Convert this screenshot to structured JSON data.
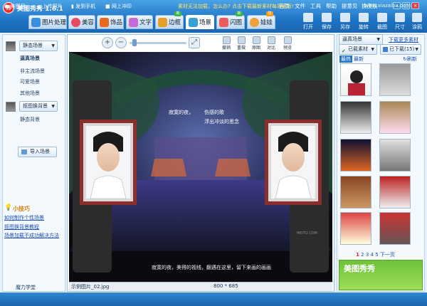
{
  "app": {
    "logo_text": "秀",
    "title": "美图秀秀 1.6.1"
  },
  "menu": [
    {
      "label": "首页"
    },
    {
      "label": "文件"
    },
    {
      "label": "工具"
    },
    {
      "label": "帮助"
    },
    {
      "label": "提意见"
    },
    {
      "label": "换皮肤"
    }
  ],
  "tabs": [
    {
      "label": "图片处理"
    },
    {
      "label": "美容"
    },
    {
      "label": "饰品"
    },
    {
      "label": "文字"
    },
    {
      "label": "边框",
      "badge": "新"
    },
    {
      "label": "场景"
    },
    {
      "label": "闪图",
      "badge": "新"
    },
    {
      "label": "娃娃",
      "badge": "热"
    }
  ],
  "tools": [
    {
      "label": "打开"
    },
    {
      "label": "保存"
    },
    {
      "label": "另存"
    },
    {
      "label": "旋转"
    },
    {
      "label": "截图"
    },
    {
      "label": "尺寸"
    },
    {
      "label": "涂鸦"
    }
  ],
  "left": {
    "dropdown1": "静态场景",
    "items1": [
      "逼真场景",
      "非主流场景",
      "可爱场景",
      "其他场景"
    ],
    "dropdown2": "抠图换背景",
    "items2": [
      "静态背景"
    ],
    "import": "导入场景",
    "tips_title": "小技巧",
    "tips": [
      "如何制作个性场景",
      "抠图换背景教程",
      "场景加载不成功解决方法"
    ],
    "footer": "魔力学堂"
  },
  "center": {
    "buttons": [
      "撤销",
      "重做",
      "原图",
      "对比",
      "预览"
    ],
    "filename": "示例图片_02.jpg",
    "dimensions": "800 * 685",
    "sign_line1": "寂寞的夜，",
    "sign_line2": "伤感的歌",
    "sign_line3": "浮出冲淡的思念",
    "caption": "寂寞的夜，美得的视线，翻遇在这里，留下来画的画画",
    "watermark": "MEITU.COM"
  },
  "right": {
    "dropdown": "逼真场景",
    "more": "下载更多素材",
    "filter": "已载素材",
    "downloaded": "已下载(15)",
    "hot": "最热",
    "new": "最新",
    "refresh": "刷新",
    "pages": [
      "1",
      "2",
      "3",
      "4",
      "5"
    ],
    "next": "下一页",
    "banner": "美图秀秀"
  },
  "bottom": {
    "items": [
      "美图网",
      "上传照片",
      "发到手机",
      "网上冲印"
    ],
    "notice": "素材无法加载，怎么办? 点击下载最新素材每周更新!",
    "site": "www.xiazaiba.com"
  },
  "colors": {
    "titlebar": "#1f74c4",
    "panel": "#f4f9fe",
    "accent": "#e8312f",
    "link": "#1a4fb3"
  }
}
